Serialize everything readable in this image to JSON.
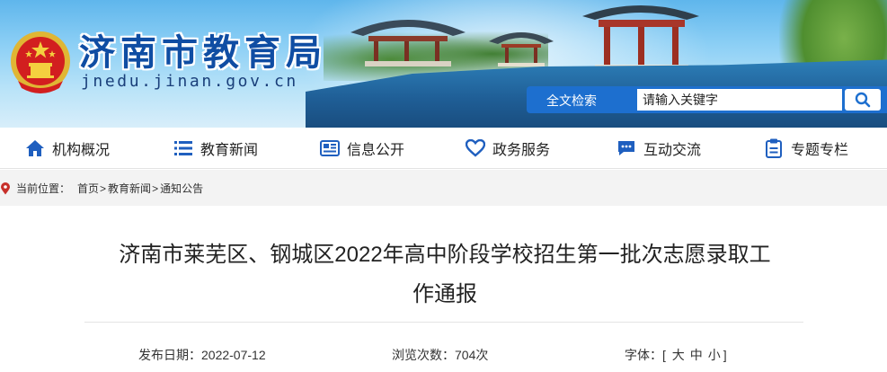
{
  "header": {
    "site_title": "济南市教育局",
    "site_domain": "jnedu.jinan.gov.cn",
    "title_color": "#0f4da3"
  },
  "search": {
    "label": "全文检索",
    "placeholder": "请输入关键字",
    "button_icon": "search-icon",
    "accent": "#1d6fcf"
  },
  "nav": {
    "items": [
      {
        "label": "机构概况",
        "icon": "home-icon"
      },
      {
        "label": "教育新闻",
        "icon": "list-icon"
      },
      {
        "label": "信息公开",
        "icon": "newspaper-icon"
      },
      {
        "label": "政务服务",
        "icon": "heart-icon"
      },
      {
        "label": "互动交流",
        "icon": "chat-icon"
      },
      {
        "label": "专题专栏",
        "icon": "clipboard-icon"
      }
    ],
    "icon_color": "#1f5fbf"
  },
  "breadcrumb": {
    "lead": "当前位置：",
    "items": [
      "首页",
      "教育新闻",
      "通知公告"
    ],
    "separator": ">"
  },
  "article": {
    "title_line1": "济南市莱芜区、钢城区2022年高中阶段学校招生第一批次志愿录取工",
    "title_line2": "作通报",
    "publish_label": "发布日期：",
    "publish_date": "2022-07-12",
    "views_label": "浏览次数：",
    "views_count": "704次",
    "font_label": "字体：",
    "font_open": "[",
    "font_large": "大",
    "font_medium": "中",
    "font_small": "小",
    "font_close": "]"
  }
}
